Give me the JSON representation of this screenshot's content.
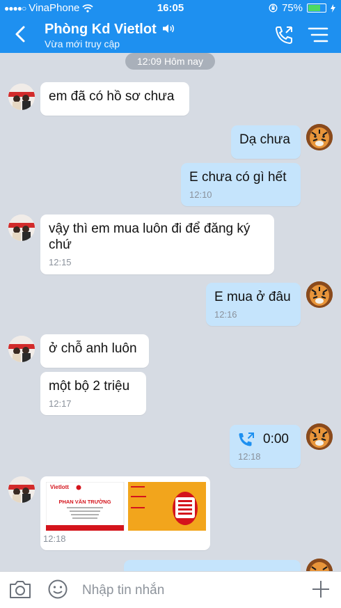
{
  "status_bar": {
    "carrier": "VinaPhone",
    "time": "16:05",
    "battery": "75%",
    "battery_level": 0.75
  },
  "header": {
    "title": "Phòng Kd Vietlot",
    "subtitle": "Vừa mới truy cập"
  },
  "chat": {
    "date_label": "12:09 Hôm nay",
    "messages": [
      {
        "side": "in",
        "text": "em đã có hồ sơ chưa",
        "time": ""
      },
      {
        "side": "out",
        "text": "Dạ chưa",
        "time": ""
      },
      {
        "side": "out",
        "text": "E chưa có gì hết",
        "time": "12:10"
      },
      {
        "side": "in",
        "text": "vậy thì em mua luôn đi để đăng ký chứ",
        "time": "12:15"
      },
      {
        "side": "out",
        "text": "E mua ở đâu",
        "time": "12:16"
      },
      {
        "side": "in",
        "text": "ở chỗ anh luôn",
        "time": ""
      },
      {
        "side": "in",
        "text": "một bộ 2 triệu",
        "time": "12:17"
      },
      {
        "side": "out",
        "call_duration": "0:00",
        "time": "12:18"
      },
      {
        "side": "in",
        "type": "image",
        "time": "12:18",
        "card": {
          "logo": "Vietlott",
          "name": "PHAN VĂN TRƯỜNG"
        }
      }
    ]
  },
  "input_bar": {
    "placeholder": "Nhập tin nhắn"
  },
  "colors": {
    "accent": "#1e90f0",
    "incoming": "#ffffff",
    "outgoing": "#c5e4fc",
    "background": "#d6dbe3"
  }
}
